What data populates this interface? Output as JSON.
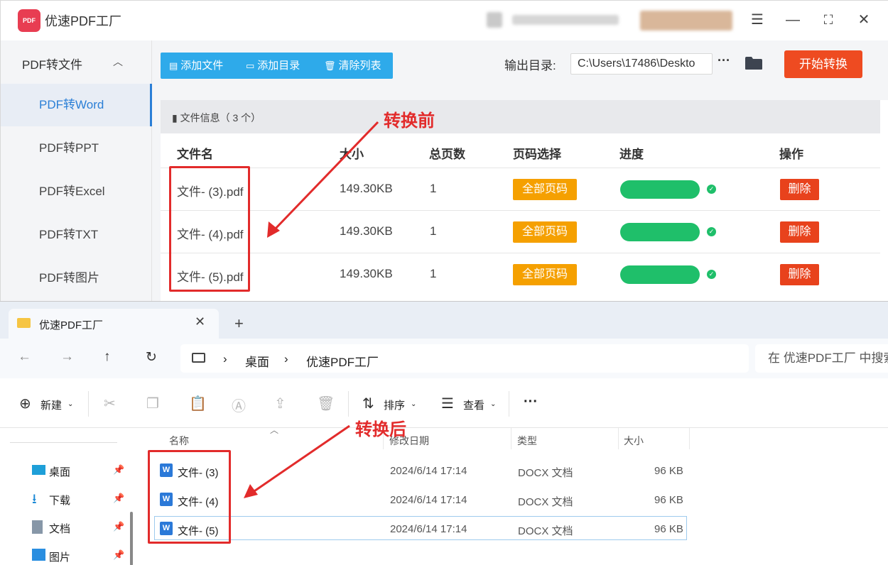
{
  "app": {
    "title": "优速PDF工厂",
    "logo_text": "PDF",
    "window_controls": [
      "menu-icon",
      "minimize-icon",
      "maximize-icon",
      "close-icon"
    ],
    "sidebar": {
      "section": "PDF转文件",
      "items": [
        {
          "label": "PDF转Word",
          "active": true
        },
        {
          "label": "PDF转PPT",
          "active": false
        },
        {
          "label": "PDF转Excel",
          "active": false
        },
        {
          "label": "PDF转TXT",
          "active": false
        },
        {
          "label": "PDF转图片",
          "active": false
        }
      ]
    },
    "toolbar": {
      "add_file": "添加文件",
      "add_folder": "添加目录",
      "clear_list": "清除列表",
      "output_label": "输出目录:",
      "output_path": "C:\\Users\\17486\\Deskto",
      "more": "···",
      "start": "开始转换"
    },
    "file_info": "文件信息（ 3 个）",
    "columns": [
      "文件名",
      "大小",
      "总页数",
      "页码选择",
      "进度",
      "操作"
    ],
    "files": [
      {
        "name": "文件- (3).pdf",
        "size": "149.30KB",
        "pages": "1",
        "page_select": "全部页码",
        "progress": 1.0,
        "action": "删除"
      },
      {
        "name": "文件- (4).pdf",
        "size": "149.30KB",
        "pages": "1",
        "page_select": "全部页码",
        "progress": 1.0,
        "action": "删除"
      },
      {
        "name": "文件- (5).pdf",
        "size": "149.30KB",
        "pages": "1",
        "page_select": "全部页码",
        "progress": 1.0,
        "action": "删除"
      }
    ],
    "colors": {
      "accent_blue": "#2eaaea",
      "start_red": "#ee4b21",
      "badge_orange": "#f5a000",
      "progress_green": "#1fbf6a",
      "delete_red": "#e8421c"
    }
  },
  "explorer": {
    "tab_title": "优速PDF工厂",
    "breadcrumb": [
      "桌面",
      "优速PDF工厂"
    ],
    "search_placeholder": "在 优速PDF工厂 中搜索",
    "commands": {
      "new": "新建",
      "sort": "排序",
      "view": "查看",
      "more": "···"
    },
    "nav": [
      {
        "label": "桌面",
        "icon": "desktop-icon"
      },
      {
        "label": "下载",
        "icon": "download-icon"
      },
      {
        "label": "文档",
        "icon": "document-icon"
      },
      {
        "label": "图片",
        "icon": "picture-icon"
      }
    ],
    "columns": [
      "名称",
      "修改日期",
      "类型",
      "大小"
    ],
    "files": [
      {
        "name": "文件- (3)",
        "modified": "2024/6/14 17:14",
        "type": "DOCX 文档",
        "size": "96 KB"
      },
      {
        "name": "文件- (4)",
        "modified": "2024/6/14 17:14",
        "type": "DOCX 文档",
        "size": "96 KB"
      },
      {
        "name": "文件- (5)",
        "modified": "2024/6/14 17:14",
        "type": "DOCX 文档",
        "size": "96 KB"
      }
    ]
  },
  "annotations": {
    "before": "转换前",
    "after": "转换后"
  }
}
